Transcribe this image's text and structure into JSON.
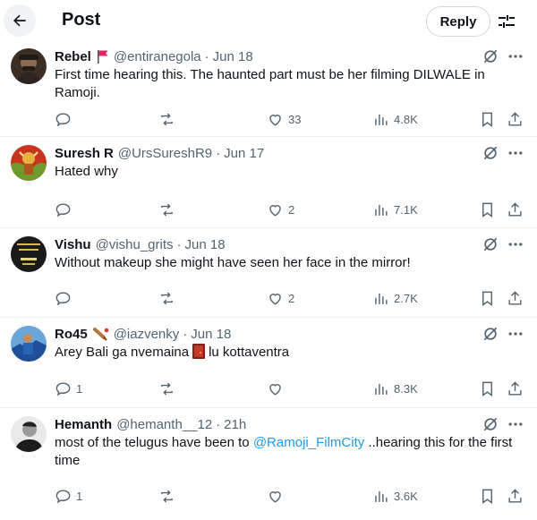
{
  "header": {
    "title": "Post",
    "reply_label": "Reply"
  },
  "replies": [
    {
      "name": "Rebel",
      "flag": true,
      "handle": "@entiranegola",
      "date": "Jun 18",
      "text": "First time hearing this. The haunted part must be her filming DILWALE in Ramoji.",
      "replies": "",
      "reposts": "",
      "likes": "33",
      "views": "4.8K"
    },
    {
      "name": "Suresh R",
      "handle": "@UrsSureshR9",
      "date": "Jun 17",
      "text": "Hated why",
      "replies": "",
      "reposts": "",
      "likes": "2",
      "views": "7.1K"
    },
    {
      "name": "Vishu",
      "handle": "@vishu_grits",
      "date": "Jun 18",
      "text": "Without makeup she might have seen her face in the mirror!",
      "replies": "",
      "reposts": "",
      "likes": "2",
      "views": "2.7K"
    },
    {
      "name": "Ro45",
      "handle": "@iazvenky",
      "date": "Jun 18",
      "text_before": "Arey Bali ga nvemaina",
      "text_after": "lu kottaventra",
      "emoji": "door-emoji",
      "replies": "1",
      "reposts": "",
      "likes": "",
      "views": "8.3K"
    },
    {
      "name": "Hemanth",
      "handle": "@hemanth__12",
      "date": "21h",
      "text_before": "most of the telugus have been to",
      "mention": "@Ramoji_FilmCity",
      "text_after": "..hearing this for the first time",
      "replies": "1",
      "reposts": "",
      "likes": "",
      "views": "3.6K"
    }
  ],
  "separator": "·",
  "colors": {
    "accent": "#1d9bf0",
    "secondary_text": "#536471",
    "divider": "#eff3f4"
  }
}
